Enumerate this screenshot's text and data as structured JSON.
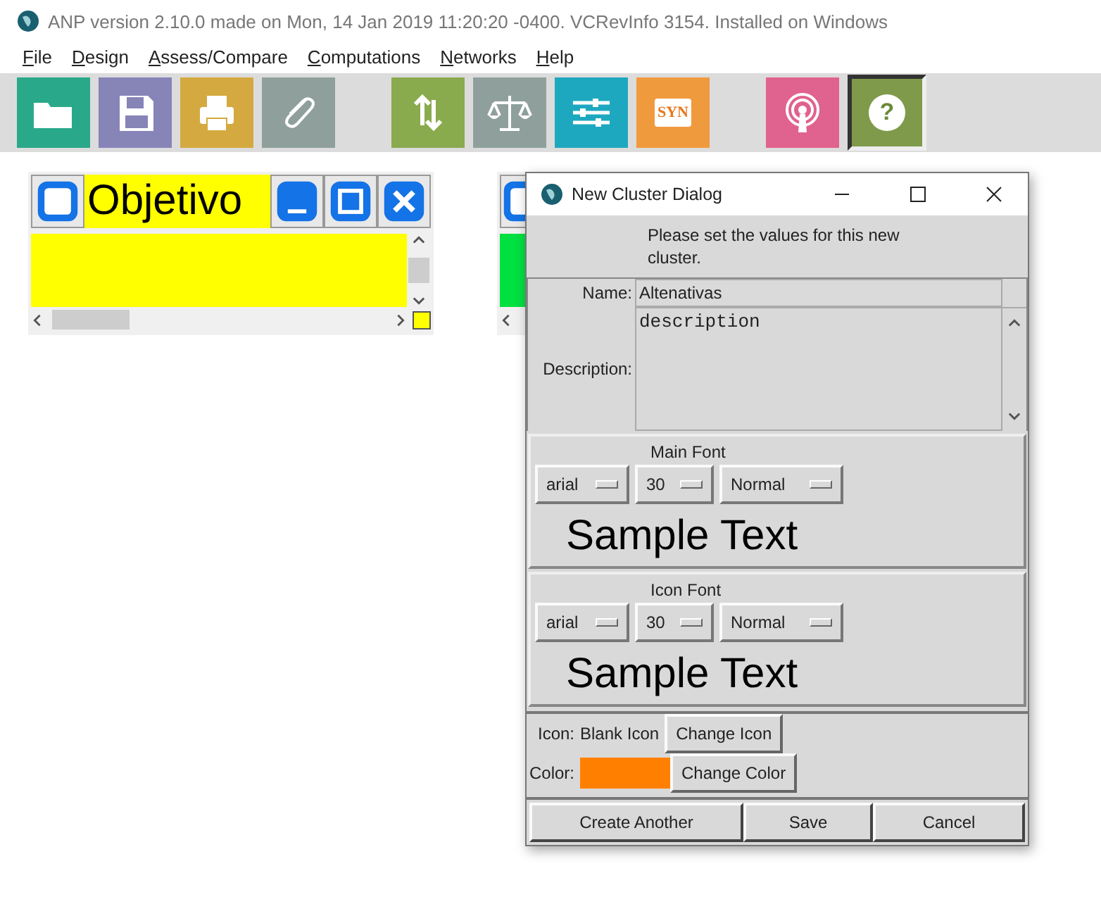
{
  "window": {
    "title": "ANP version 2.10.0 made on Mon, 14 Jan 2019 11:20:20 -0400.  VCRevInfo 3154.  Installed on Windows"
  },
  "menu": [
    "File",
    "Design",
    "Assess/Compare",
    "Computations",
    "Networks",
    "Help"
  ],
  "toolbar": [
    {
      "kind": "folder",
      "color": "#2aa98a",
      "selected": false,
      "group_start": false
    },
    {
      "kind": "floppy",
      "color": "#8784b8",
      "selected": false,
      "group_start": false
    },
    {
      "kind": "printer",
      "color": "#d4a940",
      "selected": false,
      "group_start": false
    },
    {
      "kind": "paperclip",
      "color": "#8fa09c",
      "selected": false,
      "group_start": false
    },
    {
      "kind": "cycle",
      "color": "#8aaa4e",
      "selected": false,
      "group_start": true
    },
    {
      "kind": "scale",
      "color": "#8fa09c",
      "selected": false,
      "group_start": false
    },
    {
      "kind": "sliders",
      "color": "#1ea8c0",
      "selected": false,
      "group_start": false
    },
    {
      "kind": "text",
      "label": "SYN",
      "color": "#f09a3e",
      "selected": false,
      "group_start": false
    },
    {
      "kind": "broadcast",
      "color": "#e0628e",
      "selected": false,
      "group_start": true
    },
    {
      "kind": "help",
      "label": "?",
      "color": "#7f9a4a",
      "selected": true,
      "group_start": false
    }
  ],
  "clusters": [
    {
      "title": "Objetivo",
      "color": "#ffff00"
    },
    {
      "color": "#00e040"
    }
  ],
  "dialog": {
    "title": "New Cluster Dialog",
    "message": "Please set the values for this new cluster.",
    "name_label": "Name:",
    "name": "Altenativas",
    "description_label": "Description:",
    "description": "description",
    "fonts": [
      {
        "label": "Main Font",
        "font": "arial",
        "size": "30",
        "style": "Normal",
        "sample": "Sample Text"
      },
      {
        "label": "Icon Font",
        "font": "arial",
        "size": "30",
        "style": "Normal",
        "sample": "Sample Text"
      }
    ],
    "icon_label": "Icon:",
    "icon_value": "Blank Icon",
    "change_icon": "Change Icon",
    "color_label": "Color:",
    "color": "#ff8000",
    "change_color": "Change Color",
    "buttons": [
      "Create Another",
      "Save",
      "Cancel"
    ]
  }
}
